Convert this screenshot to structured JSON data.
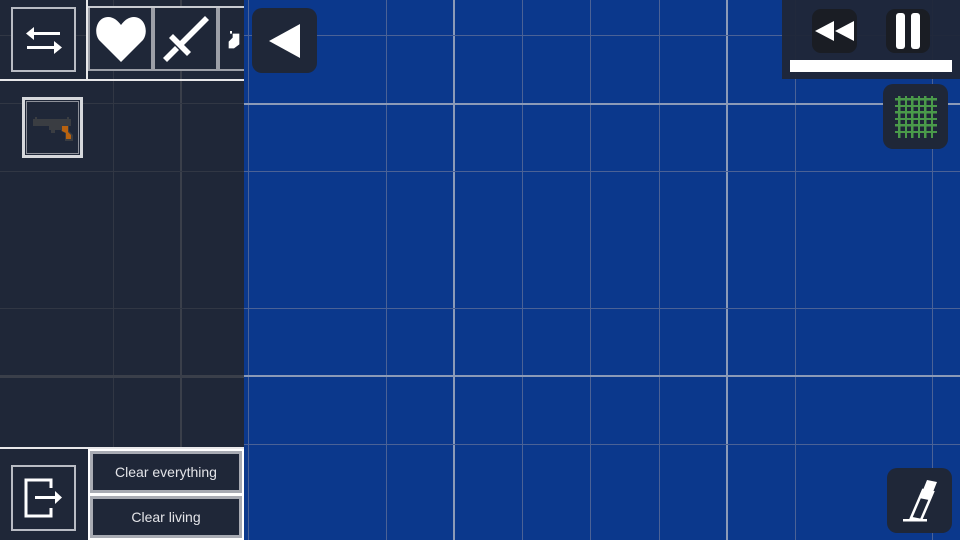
{
  "colors": {
    "background": "#0b388c",
    "panel": "#1f2738",
    "grid_minor": "#4b6296",
    "grid_major": "#8b9ab8",
    "grid_icon_green": "#4a9a4a",
    "gun_grip": "#b8620f"
  },
  "left_panel": {
    "swap_button": {
      "icon": "swap-arrows-icon"
    },
    "category_tabs": [
      {
        "icon": "heart-icon",
        "name": "Biological"
      },
      {
        "icon": "sword-icon",
        "name": "Melee"
      },
      {
        "icon": "firearm-icon",
        "name": "Firearms"
      }
    ],
    "items": [
      {
        "icon": "pistol-icon",
        "name": "Pistol"
      }
    ],
    "exit_button": {
      "icon": "exit-icon"
    },
    "clear_everything_label": "Clear everything",
    "clear_living_label": "Clear living"
  },
  "collapse_button": {
    "icon": "triangle-left-icon"
  },
  "time_controls": {
    "rewind_icon": "rewind-icon",
    "pause_icon": "pause-icon",
    "time_scale": 1.0
  },
  "grid_toggle": {
    "icon": "grid-icon",
    "enabled": true
  },
  "eraser_button": {
    "icon": "eraser-icon"
  }
}
